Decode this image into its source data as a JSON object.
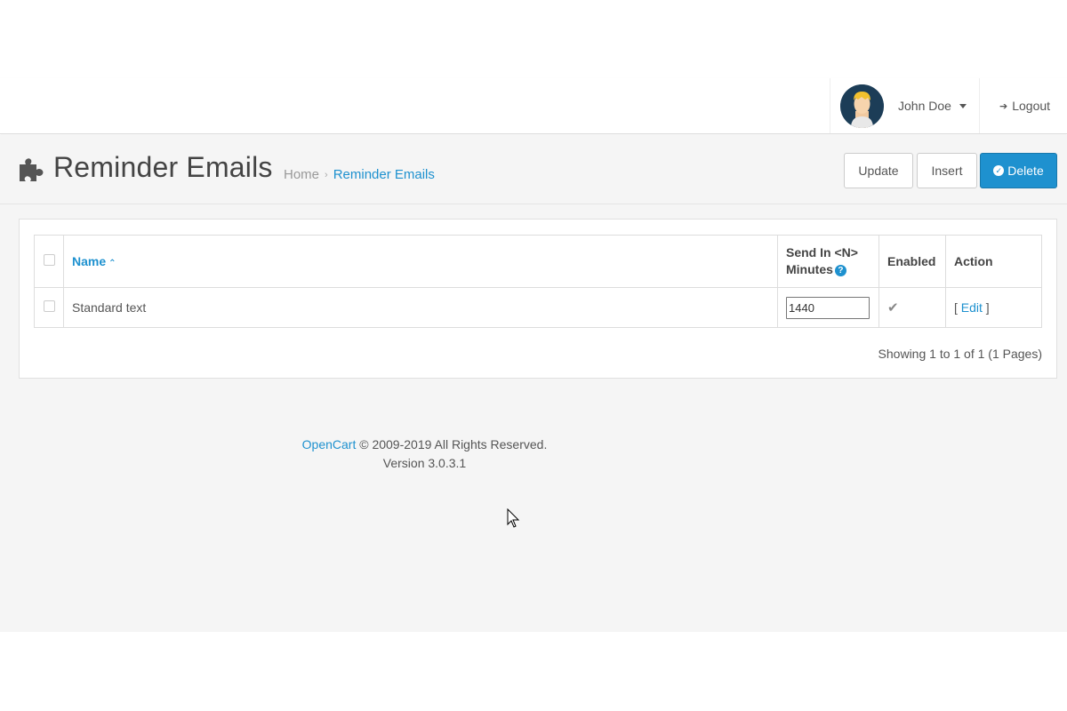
{
  "header": {
    "user_name": "John Doe",
    "logout_label": "Logout"
  },
  "page": {
    "title": "Reminder Emails",
    "breadcrumb": [
      "Home",
      "Reminder Emails"
    ]
  },
  "toolbar": {
    "update_label": "Update",
    "insert_label": "Insert",
    "delete_label": "Delete"
  },
  "table": {
    "columns": {
      "name": "Name",
      "send_in_line1": "Send In <N>",
      "send_in_line2": "Minutes",
      "enabled": "Enabled",
      "action": "Action"
    },
    "rows": [
      {
        "name": "Standard text",
        "minutes": "1440",
        "enabled": true,
        "action": "Edit"
      }
    ]
  },
  "pagination": {
    "info": "Showing 1 to 1 of 1 (1 Pages)"
  },
  "footer": {
    "brand": "OpenCart",
    "copyright": "© 2009-2019 All Rights Reserved.",
    "version": "Version 3.0.3.1"
  },
  "colors": {
    "accent": "#1e91cf",
    "content_bg": "#f5f5f5"
  }
}
